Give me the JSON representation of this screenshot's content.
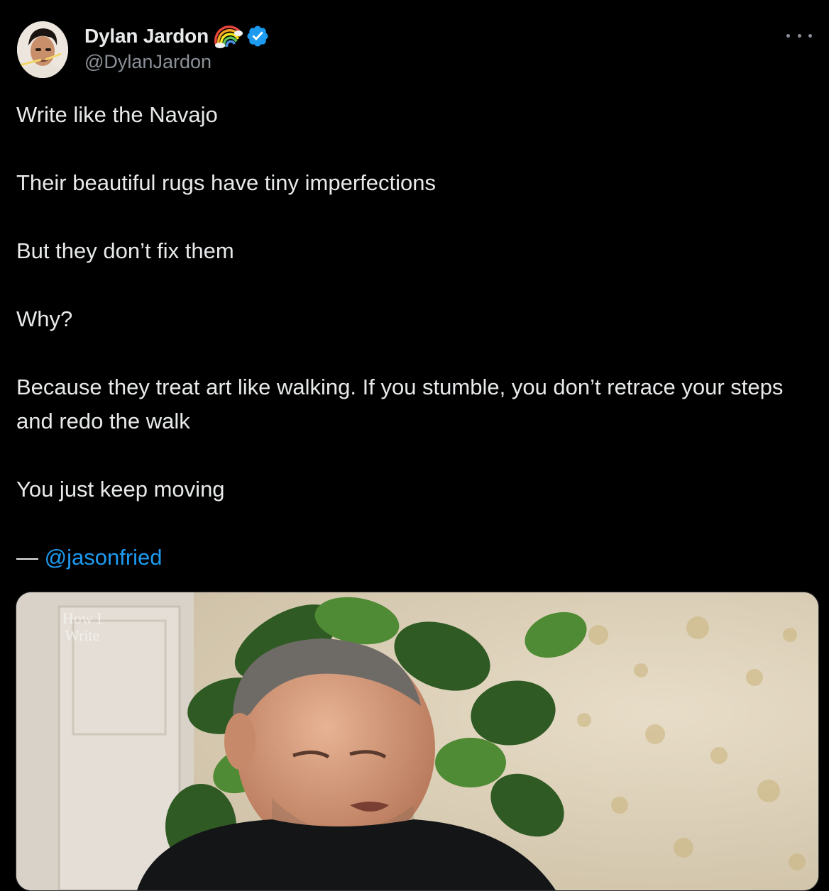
{
  "author": {
    "display_name": "Dylan Jardon",
    "handle": "@DylanJardon",
    "badge_icon": "rainbow-icon",
    "verified_icon": "verified-badge-icon",
    "verified_color": "#1d9bf0"
  },
  "menu": {
    "icon": "more-options-icon"
  },
  "tweet": {
    "paragraphs": [
      "Write like the Navajo",
      "Their beautiful rugs have tiny imperfections",
      "But they don’t fix them",
      "Why?",
      "Because they treat art like walking. If you stumble, you don’t retrace your steps and redo the walk",
      "You just keep moving"
    ],
    "attribution_prefix": "— ",
    "attribution_mention": "@jasonfried"
  },
  "media": {
    "watermark_line1": "How I",
    "watermark_line2": "Write"
  },
  "colors": {
    "background": "#000000",
    "text": "#e7e9ea",
    "secondary": "#8b9198",
    "link": "#1d9bf0"
  }
}
